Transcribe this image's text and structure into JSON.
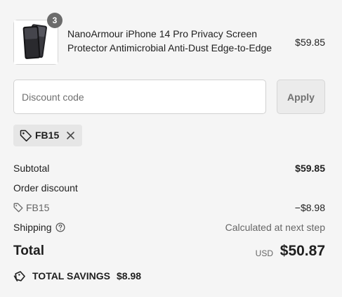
{
  "product": {
    "quantity": "3",
    "title": "NanoArmour iPhone 14 Pro Privacy Screen Protector Antimicrobial Anti-Dust Edge-to-Edge",
    "price": "$59.85"
  },
  "discount": {
    "placeholder": "Discount code",
    "value": "",
    "apply_label": "Apply"
  },
  "applied_code": {
    "label": "FB15"
  },
  "summary": {
    "subtotal_label": "Subtotal",
    "subtotal_value": "$59.85",
    "order_discount_label": "Order discount",
    "discount_code_label": "FB15",
    "discount_code_value": "−$8.98",
    "shipping_label": "Shipping",
    "shipping_value": "Calculated at next step",
    "total_label": "Total",
    "total_currency": "USD",
    "total_value": "$50.87",
    "savings_label": "TOTAL SAVINGS",
    "savings_value": "$8.98"
  },
  "icons": {
    "tag": "tag-icon",
    "remove": "close-icon",
    "help": "question-circle-icon",
    "savings": "price-tag-icon"
  },
  "colors": {
    "background": "#f5f5f5",
    "text": "#1f1f1f",
    "muted_text": "#666666",
    "badge": "#6b6b6b",
    "chip_background": "#e6e6e6",
    "apply_button_background": "#ebebeb"
  }
}
